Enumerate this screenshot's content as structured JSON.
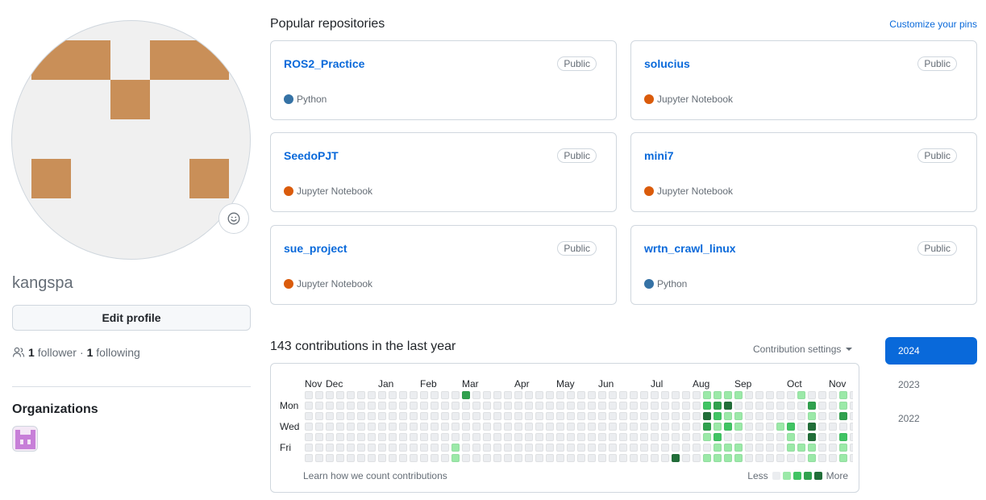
{
  "profile": {
    "username": "kangspa",
    "edit_label": "Edit profile",
    "followers_count": "1",
    "followers_label": "follower",
    "separator": "·",
    "following_count": "1",
    "following_label": "following",
    "organizations_title": "Organizations",
    "emoji_icon": "smiley-icon",
    "follow_icon": "people-icon"
  },
  "popular": {
    "title": "Popular repositories",
    "customize_label": "Customize your pins",
    "repos": [
      {
        "name": "ROS2_Practice",
        "visibility": "Public",
        "language": "Python",
        "lang_color": "#3572A5"
      },
      {
        "name": "solucius",
        "visibility": "Public",
        "language": "Jupyter Notebook",
        "lang_color": "#DA5B0B"
      },
      {
        "name": "SeedoPJT",
        "visibility": "Public",
        "language": "Jupyter Notebook",
        "lang_color": "#DA5B0B"
      },
      {
        "name": "mini7",
        "visibility": "Public",
        "language": "Jupyter Notebook",
        "lang_color": "#DA5B0B"
      },
      {
        "name": "sue_project",
        "visibility": "Public",
        "language": "Jupyter Notebook",
        "lang_color": "#DA5B0B"
      },
      {
        "name": "wrtn_crawl_linux",
        "visibility": "Public",
        "language": "Python",
        "lang_color": "#3572A5"
      }
    ]
  },
  "contributions": {
    "title": "143 contributions in the last year",
    "settings_label": "Contribution settings",
    "months": [
      "Nov",
      "Dec",
      "Jan",
      "Feb",
      "Mar",
      "Apr",
      "May",
      "Jun",
      "Jul",
      "Aug",
      "Sep",
      "Oct",
      "Nov"
    ],
    "day_labels": [
      "Mon",
      "Wed",
      "Fri"
    ],
    "learn_label": "Learn how we count contributions",
    "legend_less": "Less",
    "legend_more": "More",
    "level_colors": [
      "#ebedf0",
      "#9be9a8",
      "#40c463",
      "#30a14e",
      "#216e39"
    ],
    "active_cells": [
      {
        "week": 15,
        "day": 0,
        "level": 3
      },
      {
        "week": 14,
        "day": 5,
        "level": 1
      },
      {
        "week": 14,
        "day": 6,
        "level": 1
      },
      {
        "week": 35,
        "day": 6,
        "level": 4
      },
      {
        "week": 38,
        "day": 0,
        "level": 1
      },
      {
        "week": 38,
        "day": 1,
        "level": 2
      },
      {
        "week": 38,
        "day": 2,
        "level": 4
      },
      {
        "week": 38,
        "day": 3,
        "level": 3
      },
      {
        "week": 38,
        "day": 4,
        "level": 1
      },
      {
        "week": 38,
        "day": 6,
        "level": 1
      },
      {
        "week": 39,
        "day": 0,
        "level": 1
      },
      {
        "week": 39,
        "day": 1,
        "level": 3
      },
      {
        "week": 39,
        "day": 2,
        "level": 2
      },
      {
        "week": 39,
        "day": 3,
        "level": 1
      },
      {
        "week": 39,
        "day": 4,
        "level": 2
      },
      {
        "week": 39,
        "day": 5,
        "level": 1
      },
      {
        "week": 39,
        "day": 6,
        "level": 1
      },
      {
        "week": 40,
        "day": 0,
        "level": 1
      },
      {
        "week": 40,
        "day": 1,
        "level": 4
      },
      {
        "week": 40,
        "day": 2,
        "level": 1
      },
      {
        "week": 40,
        "day": 3,
        "level": 2
      },
      {
        "week": 40,
        "day": 5,
        "level": 1
      },
      {
        "week": 40,
        "day": 6,
        "level": 1
      },
      {
        "week": 41,
        "day": 0,
        "level": 1
      },
      {
        "week": 41,
        "day": 2,
        "level": 1
      },
      {
        "week": 41,
        "day": 3,
        "level": 1
      },
      {
        "week": 41,
        "day": 5,
        "level": 1
      },
      {
        "week": 41,
        "day": 6,
        "level": 1
      },
      {
        "week": 45,
        "day": 3,
        "level": 1
      },
      {
        "week": 46,
        "day": 3,
        "level": 2
      },
      {
        "week": 46,
        "day": 4,
        "level": 1
      },
      {
        "week": 46,
        "day": 5,
        "level": 1
      },
      {
        "week": 47,
        "day": 0,
        "level": 1
      },
      {
        "week": 47,
        "day": 5,
        "level": 1
      },
      {
        "week": 48,
        "day": 1,
        "level": 3
      },
      {
        "week": 48,
        "day": 2,
        "level": 1
      },
      {
        "week": 48,
        "day": 3,
        "level": 4
      },
      {
        "week": 48,
        "day": 4,
        "level": 4
      },
      {
        "week": 48,
        "day": 5,
        "level": 1
      },
      {
        "week": 48,
        "day": 6,
        "level": 1
      },
      {
        "week": 51,
        "day": 0,
        "level": 1
      },
      {
        "week": 51,
        "day": 1,
        "level": 1
      },
      {
        "week": 51,
        "day": 2,
        "level": 3
      },
      {
        "week": 51,
        "day": 4,
        "level": 2
      },
      {
        "week": 51,
        "day": 5,
        "level": 1
      },
      {
        "week": 51,
        "day": 6,
        "level": 1
      }
    ]
  },
  "years": [
    "2024",
    "2023",
    "2022"
  ],
  "active_year": "2024",
  "colors": {
    "accent": "#0969da",
    "avatar_block": "#c98f58",
    "org_avatar": "#c77fd8"
  }
}
